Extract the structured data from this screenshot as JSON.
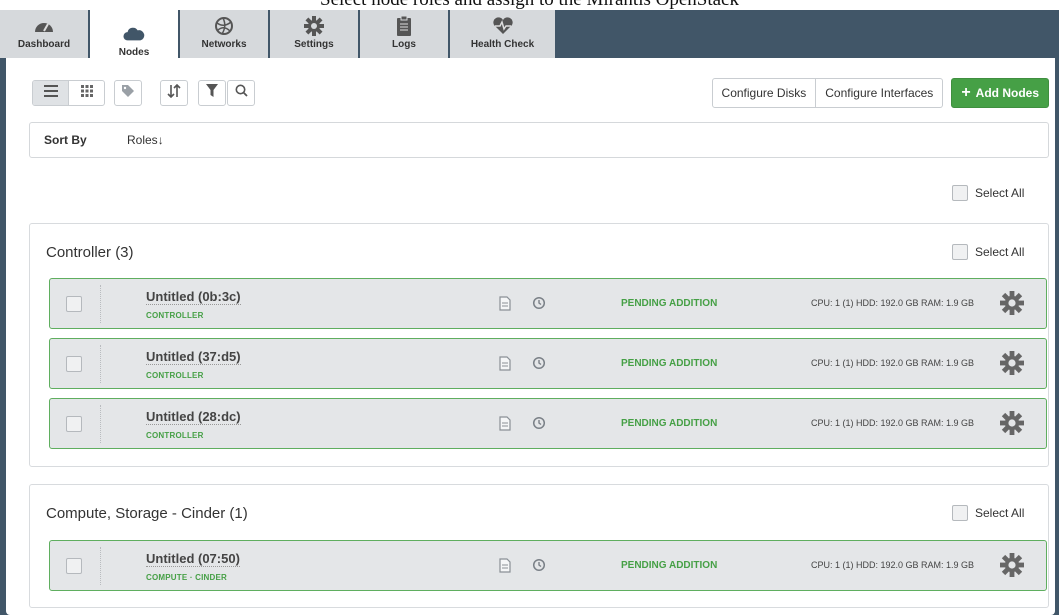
{
  "caption": "Select node roles and assign to the Mirantis OpenStack",
  "tabs": [
    {
      "label": "Dashboard",
      "icon": "dashboard-icon"
    },
    {
      "label": "Nodes",
      "icon": "cloud-icon"
    },
    {
      "label": "Networks",
      "icon": "network-globe-icon"
    },
    {
      "label": "Settings",
      "icon": "gear-icon"
    },
    {
      "label": "Logs",
      "icon": "clipboard-icon"
    },
    {
      "label": "Health Check",
      "icon": "heart-pulse-icon"
    }
  ],
  "active_tab": "Nodes",
  "toolbar": {
    "configure_disks": "Configure Disks",
    "configure_interfaces": "Configure Interfaces",
    "add_nodes": "Add Nodes",
    "add_nodes_icon": "plus-icon"
  },
  "sort": {
    "label": "Sort By",
    "value": "Roles",
    "arrow": "↓"
  },
  "select_all_label": "Select All",
  "groups": [
    {
      "title": "Controller (3)",
      "nodes": [
        {
          "name": "Untitled (0b:3c)",
          "role": "CONTROLLER",
          "status": "PENDING ADDITION",
          "specs": "CPU: 1 (1)  HDD: 192.0 GB  RAM: 1.9 GB"
        },
        {
          "name": "Untitled (37:d5)",
          "role": "CONTROLLER",
          "status": "PENDING ADDITION",
          "specs": "CPU: 1 (1)  HDD: 192.0 GB  RAM: 1.9 GB"
        },
        {
          "name": "Untitled (28:dc)",
          "role": "CONTROLLER",
          "status": "PENDING ADDITION",
          "specs": "CPU: 1 (1)  HDD: 192.0 GB  RAM: 1.9 GB"
        }
      ]
    },
    {
      "title": "Compute, Storage - Cinder (1)",
      "nodes": [
        {
          "name": "Untitled (07:50)",
          "role": "COMPUTE · CINDER",
          "status": "PENDING ADDITION",
          "specs": "CPU: 1 (1)  HDD: 192.0 GB  RAM: 1.9 GB"
        }
      ]
    }
  ],
  "colors": {
    "frame": "#415668",
    "accent_green": "#46a046",
    "node_bg": "#e4e6e8"
  }
}
